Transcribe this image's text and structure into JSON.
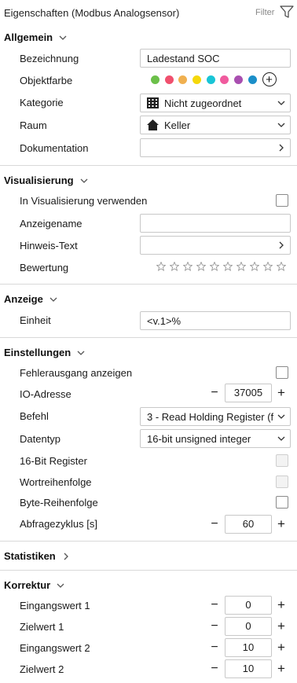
{
  "header": {
    "title": "Eigenschaften (Modbus Analogsensor)",
    "filter_label": "Filter",
    "filter_icon": "filter-funnel-icon"
  },
  "allgemein": {
    "title": "Allgemein",
    "bezeichnung_label": "Bezeichnung",
    "bezeichnung_value": "Ladestand SOC",
    "objektfarbe_label": "Objektfarbe",
    "colors": [
      "#6cc04a",
      "#f0506e",
      "#f0b050",
      "#f5d80a",
      "#19c5d6",
      "#f05b9e",
      "#a94fb0",
      "#1b8fc9"
    ],
    "kategorie_label": "Kategorie",
    "kategorie_value": "Nicht zugeordnet",
    "raum_label": "Raum",
    "raum_value": "Keller",
    "dokumentation_label": "Dokumentation"
  },
  "visualisierung": {
    "title": "Visualisierung",
    "in_vis_label": "In Visualisierung verwenden",
    "anzeigename_label": "Anzeigename",
    "hinweis_label": "Hinweis-Text",
    "bewertung_label": "Bewertung",
    "rating": 0,
    "rating_max": 10
  },
  "anzeige": {
    "title": "Anzeige",
    "einheit_label": "Einheit",
    "einheit_value": "<v.1>%"
  },
  "einstellungen": {
    "title": "Einstellungen",
    "fehlerausgang_label": "Fehlerausgang anzeigen",
    "io_label": "IO-Adresse",
    "io_value": "37005",
    "befehl_label": "Befehl",
    "befehl_value": "3 - Read Holding Register (f",
    "datentyp_label": "Datentyp",
    "datentyp_value": "16-bit unsigned integer",
    "bit16_label": "16-Bit Register",
    "wortreihenfolge_label": "Wortreihenfolge",
    "bytereihenfolge_label": "Byte-Reihenfolge",
    "abfrage_label": "Abfragezyklus [s]",
    "abfrage_value": "60"
  },
  "statistiken": {
    "title": "Statistiken"
  },
  "korrektur": {
    "title": "Korrektur",
    "rows": [
      {
        "label": "Eingangswert 1",
        "value": "0"
      },
      {
        "label": "Zielwert 1",
        "value": "0"
      },
      {
        "label": "Eingangswert 2",
        "value": "10"
      },
      {
        "label": "Zielwert 2",
        "value": "10"
      }
    ]
  },
  "stepper_minus": "−",
  "stepper_plus": "+",
  "add_color_symbol": "+"
}
